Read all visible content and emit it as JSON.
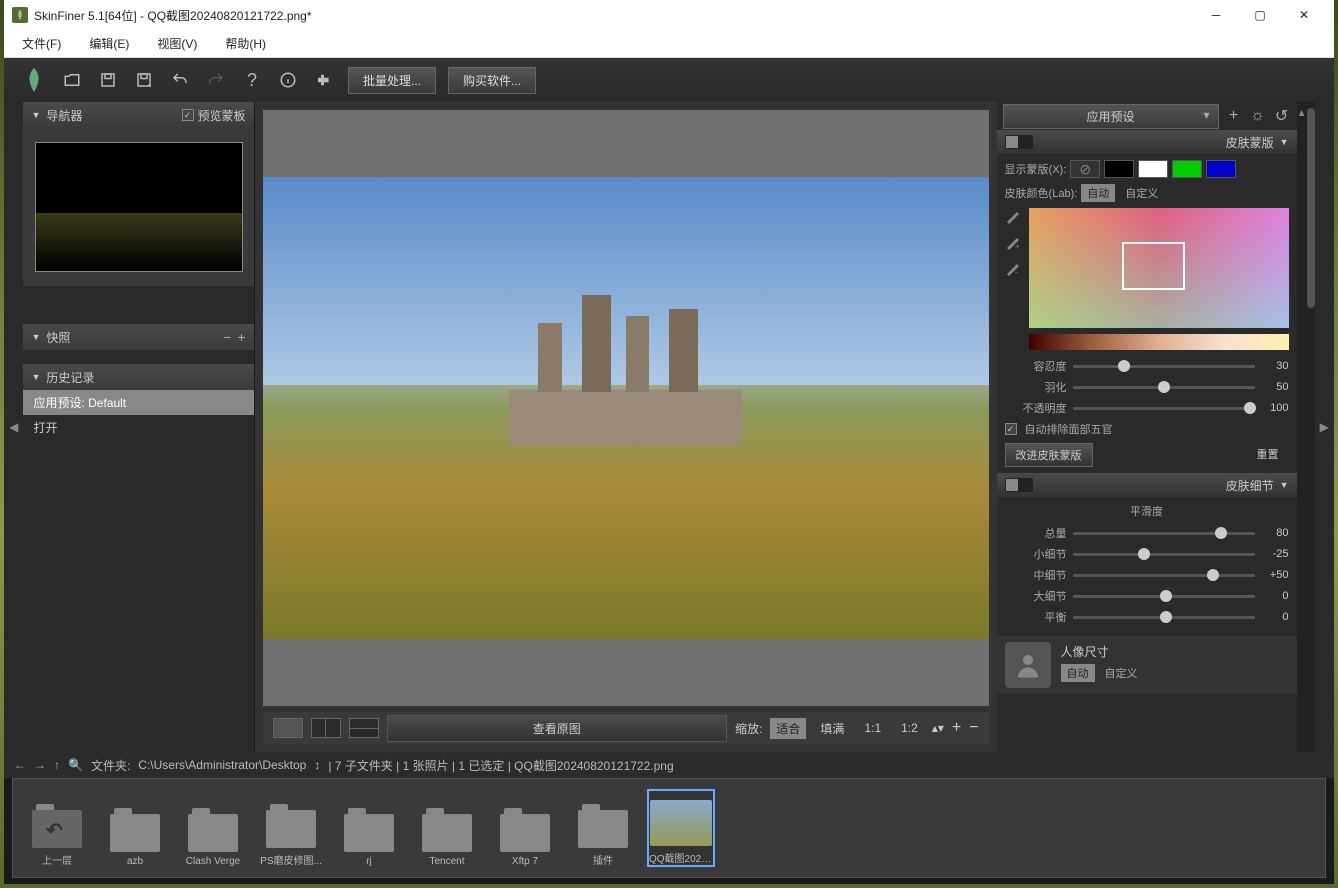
{
  "title": "SkinFiner 5.1[64位] - QQ截图20240820121722.png*",
  "menu": {
    "file": "文件(F)",
    "edit": "编辑(E)",
    "view": "视图(V)",
    "help": "帮助(H)"
  },
  "toolbar": {
    "batch": "批量处理...",
    "buy": "购买软件..."
  },
  "left": {
    "navigator": "导航器",
    "preview_mask": "预览蒙板",
    "snapshots": "快照",
    "history": "历史记录",
    "history_items": [
      "应用预设: Default",
      "打开"
    ]
  },
  "viewbar": {
    "view_orig": "查看原图",
    "zoom": "缩放:",
    "fit": "适合",
    "fill": "填满",
    "z1": "1:1",
    "z2": "1:2"
  },
  "right": {
    "apply_preset": "应用预设",
    "skin_mask": "皮肤蒙版",
    "show_mask": "显示蒙版(X):",
    "skin_color": "皮肤颜色(Lab):",
    "auto": "自动",
    "custom": "自定义",
    "tolerance": {
      "label": "容忍度",
      "val": "30"
    },
    "feather": {
      "label": "羽化",
      "val": "50"
    },
    "opacity": {
      "label": "不透明度",
      "val": "100"
    },
    "auto_exclude": "自动排除面部五官",
    "improve": "改进皮肤蒙版",
    "reset": "重置",
    "skin_detail": "皮肤细节",
    "smoothness": "平滑度",
    "s_total": {
      "label": "总量",
      "val": "80"
    },
    "s_small": {
      "label": "小细节",
      "val": "-25"
    },
    "s_mid": {
      "label": "中细节",
      "val": "+50"
    },
    "s_large": {
      "label": "大细节",
      "val": "0"
    },
    "s_balance": {
      "label": "平衡",
      "val": "0"
    },
    "portrait_size": "人像尺寸"
  },
  "status": {
    "folder_label": "文件夹:",
    "path": "C:\\Users\\Administrator\\Desktop",
    "arrows": "↕",
    "info": "| 7 子文件夹 | 1 张照片 | 1 已选定 | QQ截图20240820121722.png"
  },
  "filmstrip": {
    "up": "上一层",
    "folders": [
      "azb",
      "Clash Verge",
      "PS磨皮修图...",
      "rj",
      "Tencent",
      "Xftp 7",
      "插件"
    ],
    "image": "QQ截图2024..."
  }
}
